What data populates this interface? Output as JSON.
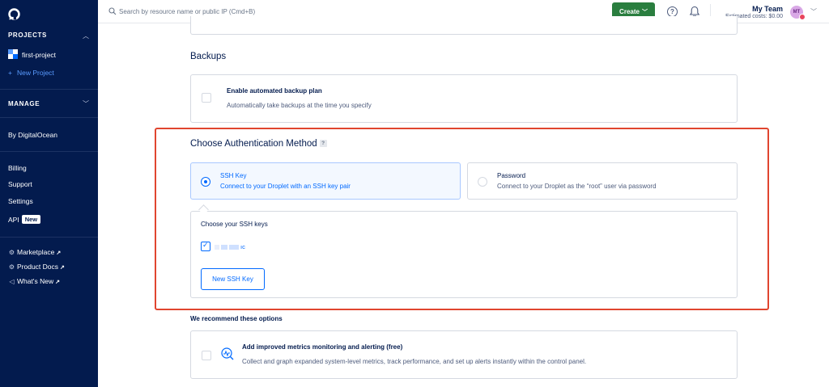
{
  "sidebar": {
    "projects_header": "PROJECTS",
    "project_name": "first-project",
    "new_project_label": "New Project",
    "manage_header": "MANAGE",
    "by_do": "By DigitalOcean",
    "billing": "Billing",
    "support": "Support",
    "settings": "Settings",
    "api": "API",
    "api_badge": "New",
    "marketplace": "Marketplace",
    "product_docs": "Product Docs",
    "whats_new": "What's New"
  },
  "topbar": {
    "search_placeholder": "Search by resource name or public IP (Cmd+B)",
    "create_label": "Create",
    "team_name": "My Team",
    "estimated_costs": "Estimated costs: $0.00",
    "avatar_initials": "MT"
  },
  "backups": {
    "heading": "Backups",
    "option_title": "Enable automated backup plan",
    "option_desc": "Automatically take backups at the time you specify"
  },
  "auth": {
    "heading": "Choose Authentication Method",
    "help": "?",
    "ssh_title": "SSH Key",
    "ssh_desc": "Connect to your Droplet with an SSH key pair",
    "password_title": "Password",
    "password_desc": "Connect to your Droplet as the “root” user via password",
    "choose_keys_label": "Choose your SSH keys",
    "key_name_suffix": "ıc",
    "new_key_button": "New SSH Key"
  },
  "recommend": {
    "heading": "We recommend these options",
    "metrics_title": "Add improved metrics monitoring and alerting (free)",
    "metrics_desc": "Collect and graph expanded system-level metrics, track performance, and set up alerts instantly within the control panel."
  },
  "colors": {
    "sidebar_bg": "#031b4e",
    "accent": "#0069ff",
    "create_green": "#2a7e3f",
    "highlight_red": "#e0452f"
  }
}
